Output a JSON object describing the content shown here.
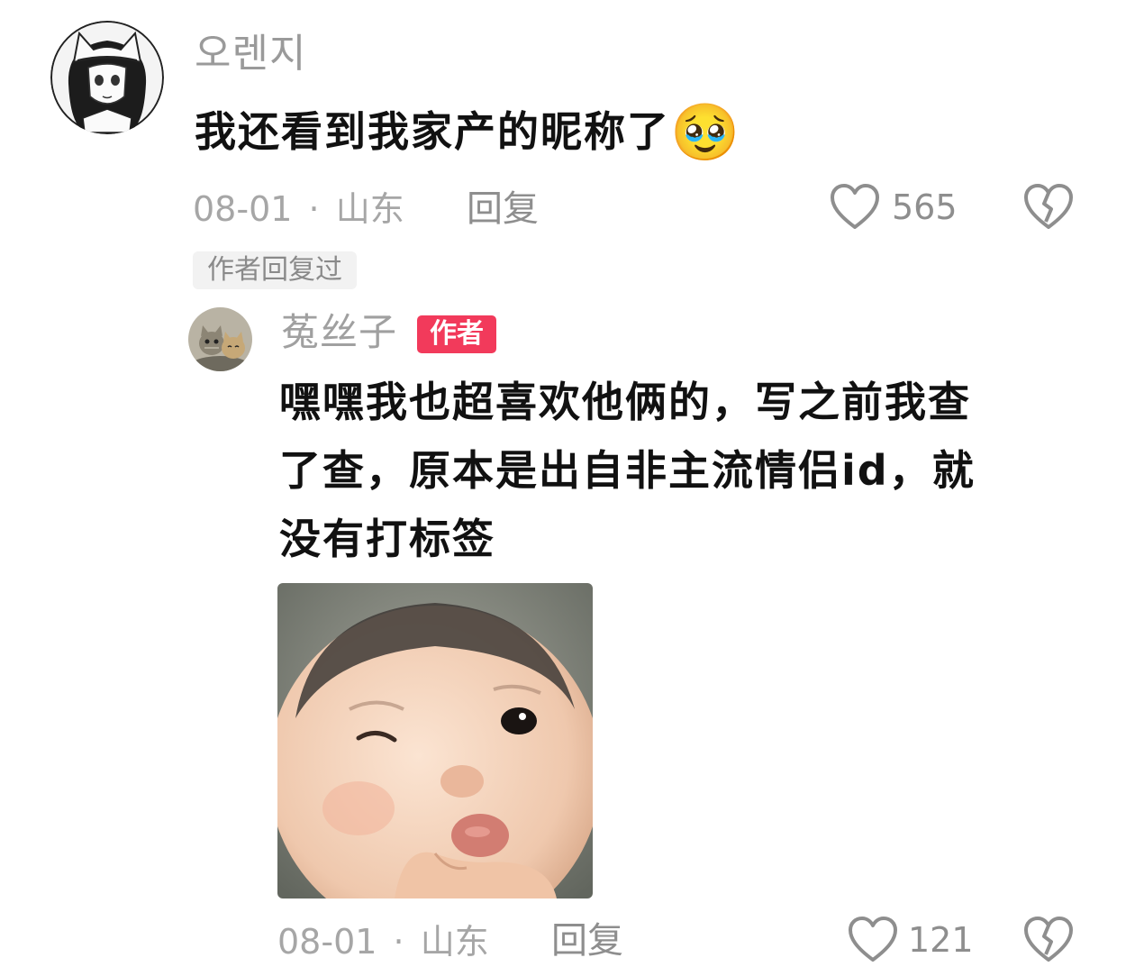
{
  "comment": {
    "username": "오렌지",
    "text": "我还看到我家产的昵称了",
    "emoji": "🥹",
    "date": "08-01",
    "separator": "·",
    "location": "山东",
    "reply_label": "回复",
    "like_count": "565",
    "author_replied_tag": "作者回复过"
  },
  "reply": {
    "username": "菟丝子",
    "author_badge": "作者",
    "text_lines": [
      "嘿嘿我也超喜欢他俩的，写之前我查",
      "了查，原本是出自非主流情侣id，就",
      "没有打标签"
    ],
    "date": "08-01",
    "separator": "·",
    "location": "山东",
    "reply_label": "回复",
    "like_count": "121"
  },
  "icons": {
    "like": "heart-outline-icon",
    "dislike": "broken-heart-icon"
  },
  "colors": {
    "author_badge": "#f23a5b",
    "muted_text": "#a6a6a6",
    "body_text": "#111111"
  }
}
